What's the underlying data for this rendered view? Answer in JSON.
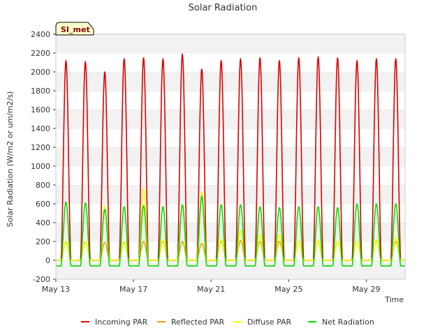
{
  "chart_data": {
    "type": "line",
    "title": "Solar Radiation",
    "xlabel": "Time",
    "ylabel": "Solar Radiation (W/m2 or um/m2/s)",
    "ylim": [
      -200,
      2400
    ],
    "yticks": [
      -200,
      0,
      200,
      400,
      600,
      800,
      1000,
      1200,
      1400,
      1600,
      1800,
      2000,
      2200,
      2400
    ],
    "xlim": [
      "2024-05-13",
      "2024-05-31"
    ],
    "xticks": [
      {
        "date": "2024-05-13",
        "label": "May 13"
      },
      {
        "date": "2024-05-17",
        "label": "May 17"
      },
      {
        "date": "2024-05-21",
        "label": "May 21"
      },
      {
        "date": "2024-05-25",
        "label": "May 25"
      },
      {
        "date": "2024-05-29",
        "label": "May 29"
      }
    ],
    "grid": "horizontal alternating bands",
    "legend_position": "bottom",
    "badge": "SI_met",
    "days": [
      "2024-05-13",
      "2024-05-14",
      "2024-05-15",
      "2024-05-16",
      "2024-05-17",
      "2024-05-18",
      "2024-05-19",
      "2024-05-20",
      "2024-05-21",
      "2024-05-22",
      "2024-05-23",
      "2024-05-24",
      "2024-05-25",
      "2024-05-26",
      "2024-05-27",
      "2024-05-28",
      "2024-05-29",
      "2024-05-30"
    ],
    "series": [
      {
        "name": "Incoming PAR",
        "color": "#dd0000",
        "night_value": 0,
        "daily_peak": [
          2120,
          2110,
          2000,
          2140,
          2150,
          2140,
          2190,
          2030,
          2120,
          2140,
          2150,
          2120,
          2150,
          2160,
          2150,
          2120,
          2140,
          2140
        ]
      },
      {
        "name": "Reflected PAR",
        "color": "#ff9900",
        "night_value": 0,
        "daily_peak": [
          190,
          190,
          190,
          190,
          200,
          200,
          200,
          180,
          200,
          210,
          200,
          200,
          200,
          200,
          200,
          200,
          210,
          200
        ]
      },
      {
        "name": "Diffuse PAR",
        "color": "#ffff00",
        "night_value": 0,
        "daily_peak": [
          200,
          200,
          580,
          200,
          760,
          220,
          590,
          720,
          220,
          320,
          270,
          270,
          200,
          210,
          200,
          200,
          220,
          240
        ]
      },
      {
        "name": "Net Radiation",
        "color": "#00dd00",
        "night_value": -60,
        "daily_peak": [
          620,
          610,
          540,
          570,
          580,
          570,
          590,
          680,
          590,
          590,
          570,
          560,
          570,
          570,
          560,
          600,
          600,
          600
        ]
      }
    ]
  }
}
